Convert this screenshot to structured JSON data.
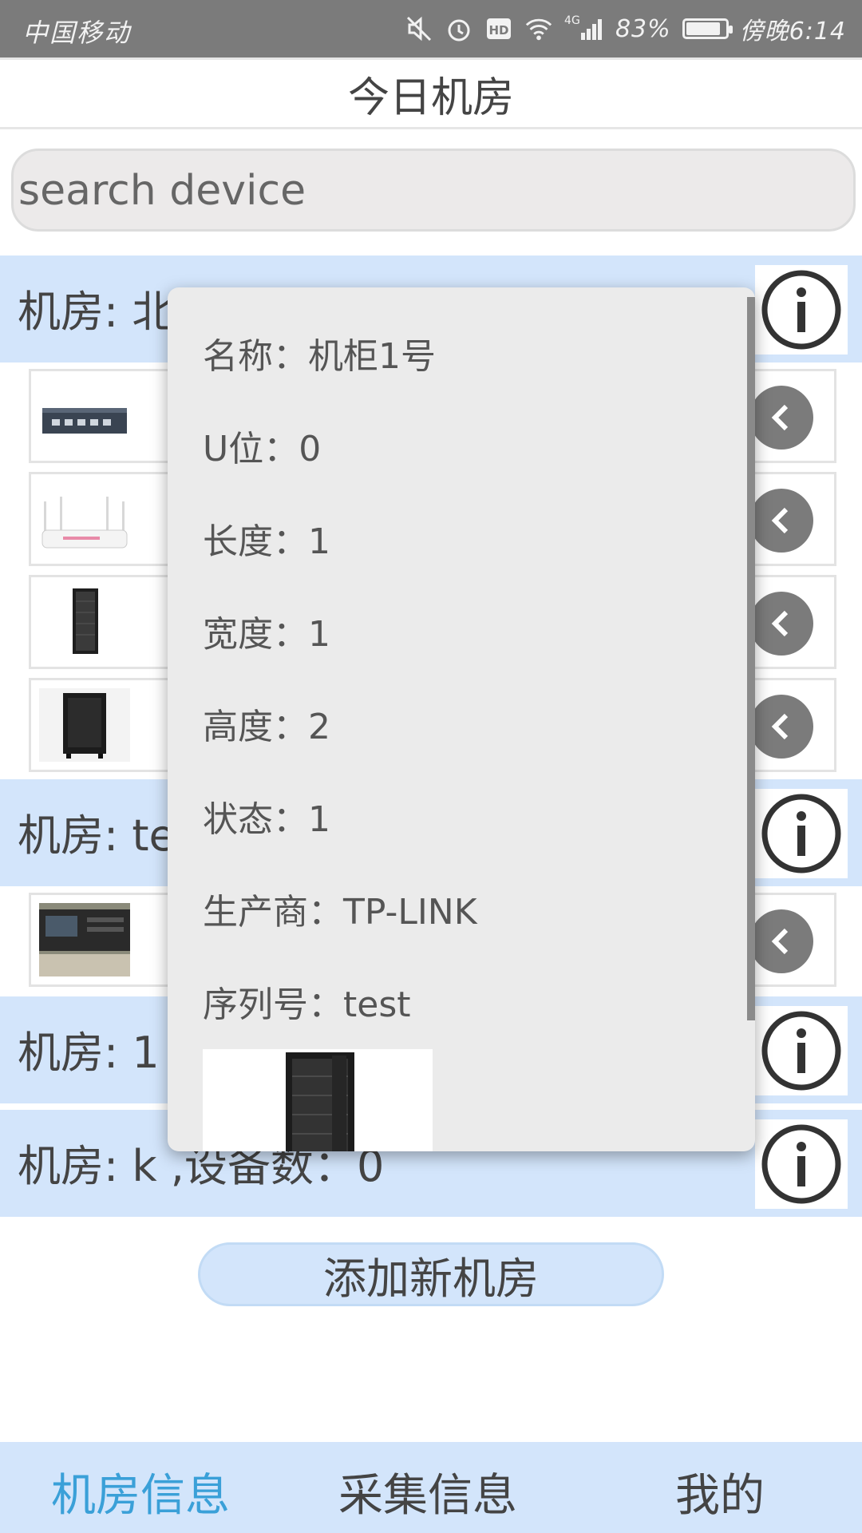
{
  "status_bar": {
    "carrier": "中国移动",
    "network": "4G",
    "battery": "83%",
    "time": "傍晚6:14"
  },
  "header": {
    "title": "今日机房"
  },
  "search": {
    "placeholder": "search device"
  },
  "rooms": [
    {
      "label": "机房: 北"
    },
    {
      "label": "机房: te"
    },
    {
      "label": "机房: 1"
    },
    {
      "label": "机房: k ,设备数：0"
    }
  ],
  "add_button": "添加新机房",
  "bottom_nav": [
    "机房信息",
    "采集信息",
    "我的"
  ],
  "popup": {
    "name": "名称：机柜1号",
    "u_position": "U位：0",
    "length": "长度：1",
    "width": "宽度：1",
    "height": "高度：2",
    "status": "状态：1",
    "manufacturer": "生产商：TP-LINK",
    "serial": "序列号：test"
  },
  "colors": {
    "accent": "#3aa0d8",
    "room_bg": "#d3e5fb",
    "status_bar": "#7b7b7b"
  }
}
